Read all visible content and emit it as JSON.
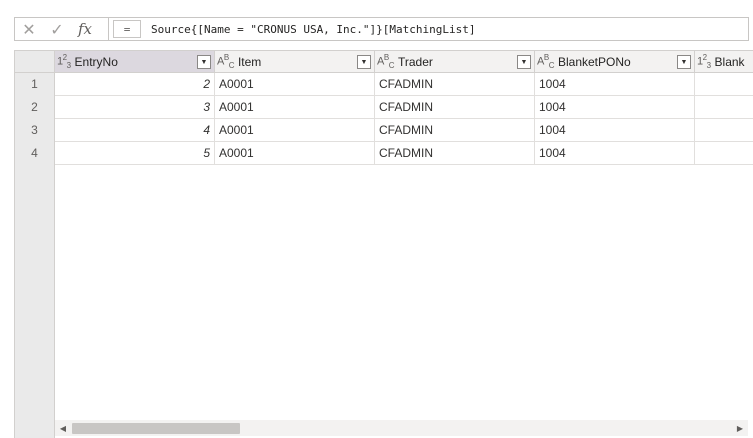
{
  "formula_bar": {
    "cancel_icon": "✕",
    "accept_icon": "✓",
    "fx_label": "fx",
    "equals_label": "=",
    "formula": "Source{[Name = \"CRONUS USA, Inc.\"]}[MatchingList]"
  },
  "columns": [
    {
      "type_icon": "123",
      "name": "EntryNo",
      "selected": true
    },
    {
      "type_icon": "ABC",
      "name": "Item",
      "selected": false
    },
    {
      "type_icon": "ABC",
      "name": "Trader",
      "selected": false
    },
    {
      "type_icon": "ABC",
      "name": "BlanketPONo",
      "selected": false
    },
    {
      "type_icon": "123",
      "name": "Blank",
      "selected": false
    }
  ],
  "row_numbers": [
    "1",
    "2",
    "3",
    "4"
  ],
  "rows": [
    {
      "entry_no": "2",
      "item": "A0001",
      "trader": "CFADMIN",
      "blanket_po_no": "1004",
      "blank": ""
    },
    {
      "entry_no": "3",
      "item": "A0001",
      "trader": "CFADMIN",
      "blanket_po_no": "1004",
      "blank": ""
    },
    {
      "entry_no": "4",
      "item": "A0001",
      "trader": "CFADMIN",
      "blanket_po_no": "1004",
      "blank": ""
    },
    {
      "entry_no": "5",
      "item": "A0001",
      "trader": "CFADMIN",
      "blanket_po_no": "1004",
      "blank": ""
    }
  ],
  "scrollbar": {
    "left_arrow": "◀",
    "right_arrow": "▶",
    "position": 0.0
  }
}
